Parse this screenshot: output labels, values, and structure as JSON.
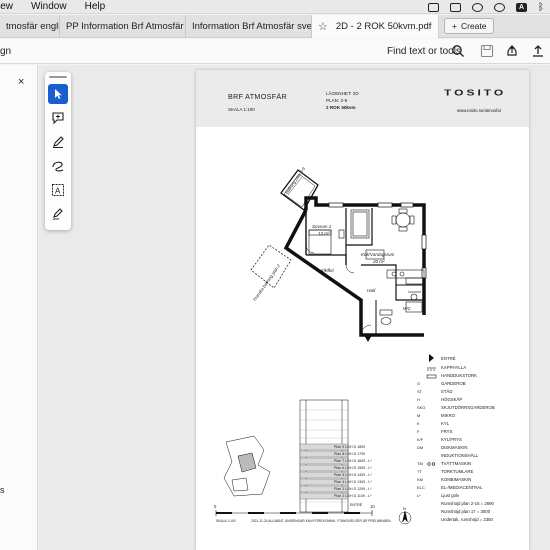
{
  "menubar": {
    "items": [
      "iew",
      "Window",
      "Help"
    ],
    "status_icons": [
      "window-icon",
      "screen-icon",
      "record-icon",
      "play-icon",
      "text-icon",
      "bluetooth-icon"
    ],
    "text_icon_label": "A"
  },
  "tabs": [
    {
      "label": "tmosfär engli..."
    },
    {
      "label": "PP Information Brf Atmosfär 2..."
    },
    {
      "label": "Information Brf Atmosfär sven..."
    },
    {
      "label": "2D - 2 ROK 50kvm.pdf",
      "active": true
    }
  ],
  "create_button": {
    "plus": "+",
    "label": "Create"
  },
  "toolbar": {
    "left_label": "gn",
    "find_label": "Find text or tools"
  },
  "left_panel": {
    "close": "×",
    "bottom_label": "s"
  },
  "document": {
    "title": "BRF ATMOSFÄR",
    "scale": "SKALA 1:100",
    "apartment": "LÄGENHET: 2D",
    "floor": "PLAN: 2-9",
    "type": "2 ROK 50kvm",
    "brand": "TOSITO",
    "website": "www.tosito.se/atmosfar",
    "rooms": {
      "bedroom": "Sovrum 1",
      "bedroom_area": "13 m²",
      "kitchen": "Kök/Vardagsrum",
      "kitchen_area": "20 m²",
      "hall": "Hall",
      "wc": "WC",
      "closet": "Klk/fkd",
      "balcony1": "Balkong plan 3-9",
      "balcony2": "Franska balkong plan 2"
    },
    "legend": [
      {
        "code": "",
        "label": "ENTRÉ"
      },
      {
        "code": "",
        "label": "KAPPHYLLA"
      },
      {
        "code": "",
        "label": "HANDDUKSTORK"
      },
      {
        "code": "G",
        "label": "GARDEROB"
      },
      {
        "code": "ST",
        "label": "STÄD"
      },
      {
        "code": "H",
        "label": "HÖGSKÅP"
      },
      {
        "code": "SKG",
        "label": "SKJUTDÖRRSGARDEROB"
      },
      {
        "code": "M",
        "label": "MIKRO"
      },
      {
        "code": "K",
        "label": "KYL"
      },
      {
        "code": "F",
        "label": "FRYS"
      },
      {
        "code": "K/F",
        "label": "KYL/FRYS"
      },
      {
        "code": "DM",
        "label": "DISKMASKIN"
      },
      {
        "code": "",
        "label": "INDUKTIONSHÄLL"
      },
      {
        "code": "TM",
        "label": "TVÄTTMASKIN"
      },
      {
        "code": "TT",
        "label": "TORKTUMLARE"
      },
      {
        "code": "KM",
        "label": "KOMBIMASKIN"
      },
      {
        "code": "ELC",
        "label": "EL-/MEDIACENTRAL"
      },
      {
        "code": "L*",
        "label": "Ljust golv"
      }
    ],
    "heights": [
      "Rumshöjd plan 2-16 = 2690",
      "Rumshöjd plan 17 = 3000",
      "Undertak, rumshöjd = 2350"
    ],
    "levels": [
      "Plan 9   LGH D 1809",
      "Plan 8   LGH D 1709",
      "Plan 7   LGH D 1609 - L*",
      "Plan 6   LGH D 1509 - L*",
      "Plan 5   LGH D 1409 - L*",
      "Plan 4   LGH D 1309 - L*",
      "Plan 3   LGH D 1209 - L*",
      "Plan 2   LGH D 1109 - L*"
    ],
    "entre_label": "ENTRÉ",
    "scalebar": {
      "start": "0",
      "end": "10",
      "label": "SKALA 1:100"
    },
    "footnote": "2021-11-24 ALLMÄNT. ÄNDRINGAR KAN FÖREKOMMA. YTANGIVELSER ÄR PRELIMINÄRA.",
    "compass": "N"
  }
}
